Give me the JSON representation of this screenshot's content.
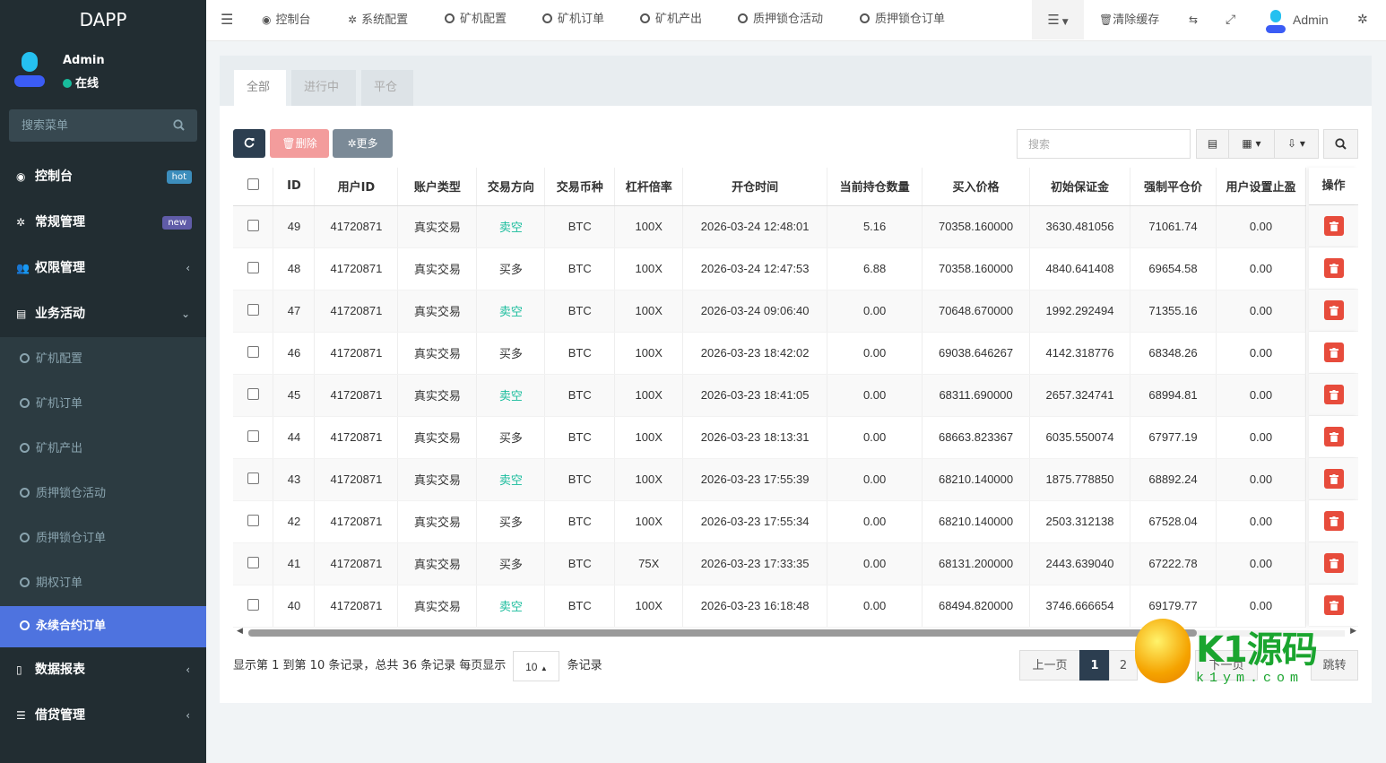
{
  "app": {
    "brand": "DAPP"
  },
  "user": {
    "name": "Admin",
    "status": "在线"
  },
  "sidebar": {
    "search_placeholder": "搜索菜单",
    "items": [
      {
        "label": "控制台",
        "badge": "hot"
      },
      {
        "label": "常规管理",
        "badge": "new"
      },
      {
        "label": "权限管理"
      },
      {
        "label": "业务活动"
      }
    ],
    "sub_items": [
      "矿机配置",
      "矿机订单",
      "矿机产出",
      "质押锁仓活动",
      "质押锁仓订单",
      "期权订单",
      "永续合约订单"
    ],
    "bottom_items": [
      {
        "label": "数据报表"
      },
      {
        "label": "借贷管理"
      }
    ]
  },
  "topnav": {
    "items": [
      "控制台",
      "系统配置",
      "矿机配置",
      "矿机订单",
      "矿机产出",
      "质押锁仓活动",
      "质押锁仓订单"
    ],
    "clear_cache": "清除缓存",
    "admin": "Admin"
  },
  "tabs": [
    "全部",
    "进行中",
    "平仓"
  ],
  "toolbar": {
    "delete": "删除",
    "more": "更多",
    "search_placeholder": "搜索"
  },
  "table": {
    "headers": [
      "ID",
      "用户ID",
      "账户类型",
      "交易方向",
      "交易币种",
      "杠杆倍率",
      "开仓时间",
      "当前持仓数量",
      "买入价格",
      "初始保证金",
      "强制平仓价",
      "用户设置止盈"
    ],
    "ops_header": "操作",
    "rows": [
      [
        "49",
        "41720871",
        "真实交易",
        "卖空",
        "BTC",
        "100X",
        "2026-03-24 12:48:01",
        "5.16",
        "70358.160000",
        "3630.481056",
        "71061.74",
        "0.00"
      ],
      [
        "48",
        "41720871",
        "真实交易",
        "买多",
        "BTC",
        "100X",
        "2026-03-24 12:47:53",
        "6.88",
        "70358.160000",
        "4840.641408",
        "69654.58",
        "0.00"
      ],
      [
        "47",
        "41720871",
        "真实交易",
        "卖空",
        "BTC",
        "100X",
        "2026-03-24 09:06:40",
        "0.00",
        "70648.670000",
        "1992.292494",
        "71355.16",
        "0.00"
      ],
      [
        "46",
        "41720871",
        "真实交易",
        "买多",
        "BTC",
        "100X",
        "2026-03-23 18:42:02",
        "0.00",
        "69038.646267",
        "4142.318776",
        "68348.26",
        "0.00"
      ],
      [
        "45",
        "41720871",
        "真实交易",
        "卖空",
        "BTC",
        "100X",
        "2026-03-23 18:41:05",
        "0.00",
        "68311.690000",
        "2657.324741",
        "68994.81",
        "0.00"
      ],
      [
        "44",
        "41720871",
        "真实交易",
        "买多",
        "BTC",
        "100X",
        "2026-03-23 18:13:31",
        "0.00",
        "68663.823367",
        "6035.550074",
        "67977.19",
        "0.00"
      ],
      [
        "43",
        "41720871",
        "真实交易",
        "卖空",
        "BTC",
        "100X",
        "2026-03-23 17:55:39",
        "0.00",
        "68210.140000",
        "1875.778850",
        "68892.24",
        "0.00"
      ],
      [
        "42",
        "41720871",
        "真实交易",
        "买多",
        "BTC",
        "100X",
        "2026-03-23 17:55:34",
        "0.00",
        "68210.140000",
        "2503.312138",
        "67528.04",
        "0.00"
      ],
      [
        "41",
        "41720871",
        "真实交易",
        "买多",
        "BTC",
        "75X",
        "2026-03-23 17:33:35",
        "0.00",
        "68131.200000",
        "2443.639040",
        "67222.78",
        "0.00"
      ],
      [
        "40",
        "41720871",
        "真实交易",
        "卖空",
        "BTC",
        "100X",
        "2026-03-23 16:18:48",
        "0.00",
        "68494.820000",
        "3746.666654",
        "69179.77",
        "0.00"
      ]
    ]
  },
  "footer": {
    "info": "显示第 1 到第 10 条记录，总共 36 条记录 每页显示",
    "page_size": "10",
    "suffix": "条记录",
    "prev": "上一页",
    "pages": [
      "1",
      "2"
    ],
    "next": "下一页",
    "jump": "跳转"
  },
  "watermark": {
    "main": "K1源码",
    "sub": "k1ym.com"
  },
  "colors": {
    "sidebar": "#222d32",
    "active": "#4e73df",
    "sell": "#18bc9c",
    "delete": "#e74c3c",
    "primary_dark": "#2c3e50"
  }
}
